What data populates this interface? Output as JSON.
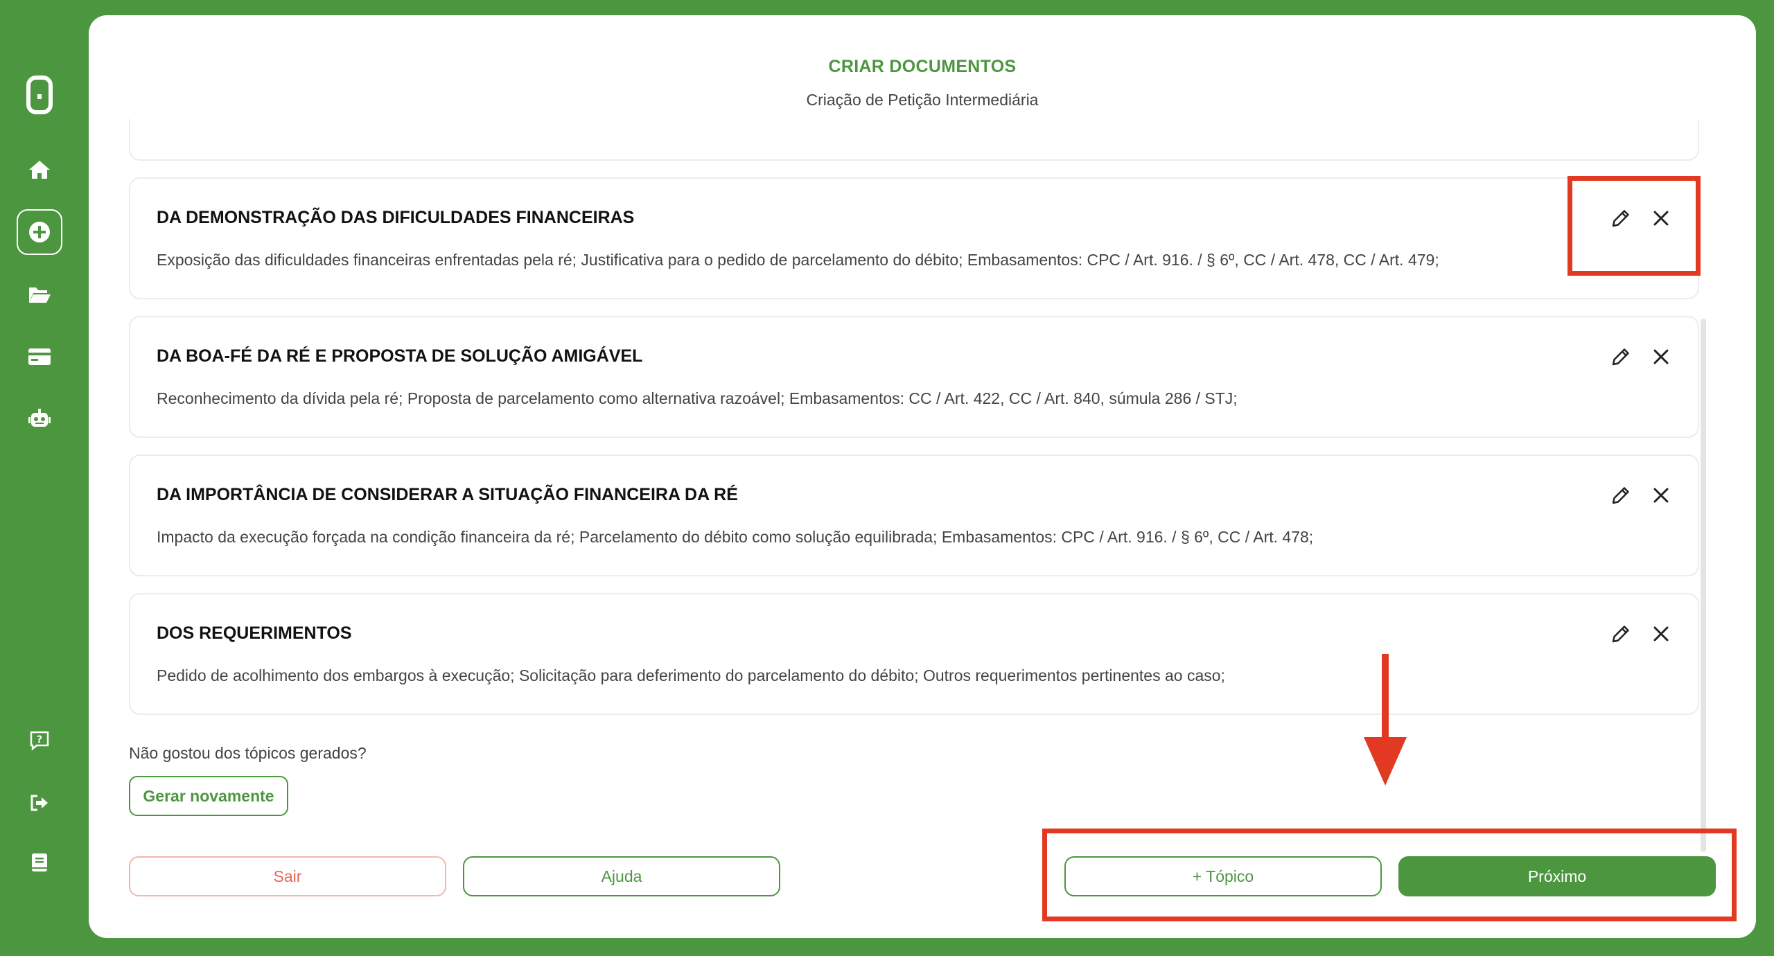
{
  "header": {
    "title": "CRIAR DOCUMENTOS",
    "subtitle": "Criação de Petição Intermediária"
  },
  "sidebar": {
    "items": [
      {
        "name": "logo",
        "icon": "logo-icon"
      },
      {
        "name": "home",
        "icon": "home-icon"
      },
      {
        "name": "new-document",
        "icon": "plus-icon"
      },
      {
        "name": "documents",
        "icon": "folder-icon"
      },
      {
        "name": "billing",
        "icon": "credit-card-icon"
      },
      {
        "name": "assistant",
        "icon": "robot-icon"
      },
      {
        "name": "help",
        "icon": "help-chat-icon"
      },
      {
        "name": "logout",
        "icon": "logout-icon"
      },
      {
        "name": "manual",
        "icon": "book-icon"
      }
    ]
  },
  "topics": [
    {
      "title": "DA DEMONSTRAÇÃO DAS DIFICULDADES FINANCEIRAS",
      "description": "Exposição das dificuldades financeiras enfrentadas pela ré; Justificativa para o pedido de parcelamento do débito; Embasamentos: CPC / Art. 916. / § 6º, CC / Art. 478, CC / Art. 479;"
    },
    {
      "title": "DA BOA-FÉ DA RÉ E PROPOSTA DE SOLUÇÃO AMIGÁVEL",
      "description": "Reconhecimento da dívida pela ré; Proposta de parcelamento como alternativa razoável; Embasamentos: CC / Art. 422, CC / Art. 840, súmula 286 / STJ;"
    },
    {
      "title": "DA IMPORTÂNCIA DE CONSIDERAR A SITUAÇÃO FINANCEIRA DA RÉ",
      "description": "Impacto da execução forçada na condição financeira da ré; Parcelamento do débito como solução equilibrada; Embasamentos: CPC / Art. 916. / § 6º, CC / Art. 478;"
    },
    {
      "title": "DOS REQUERIMENTOS",
      "description": "Pedido de acolhimento dos embargos à execução; Solicitação para deferimento do parcelamento do débito; Outros requerimentos pertinentes ao caso;"
    }
  ],
  "regenerate": {
    "question": "Não gostou dos tópicos gerados?",
    "button": "Gerar novamente"
  },
  "footer": {
    "exit": "Sair",
    "help": "Ajuda",
    "add_topic": "+ Tópico",
    "next": "Próximo"
  },
  "colors": {
    "brand_green": "#4d9640",
    "danger": "#ef6454",
    "annotation_red": "#e23a22"
  }
}
